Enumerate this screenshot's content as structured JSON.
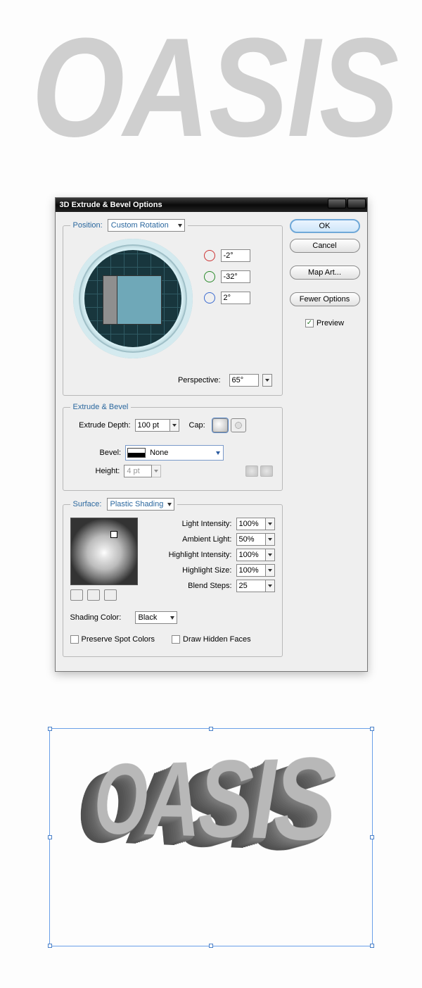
{
  "oasis_text": "OASIS",
  "dialog": {
    "title": "3D Extrude & Bevel Options",
    "buttons": {
      "ok": "OK",
      "cancel": "Cancel",
      "map_art": "Map Art...",
      "fewer_options": "Fewer Options"
    },
    "preview": {
      "label": "Preview",
      "checked": true
    },
    "position": {
      "legend": "Position:",
      "preset": "Custom Rotation",
      "rot_x": "-2°",
      "rot_y": "-32°",
      "rot_z": "2°",
      "perspective_label": "Perspective:",
      "perspective": "65°"
    },
    "extrude": {
      "legend": "Extrude & Bevel",
      "depth_label": "Extrude Depth:",
      "depth": "100 pt",
      "cap_label": "Cap:",
      "bevel_label": "Bevel:",
      "bevel": "None",
      "height_label": "Height:",
      "height": "4 pt"
    },
    "surface": {
      "legend": "Surface:",
      "shading": "Plastic Shading",
      "light_intensity_label": "Light Intensity:",
      "light_intensity": "100%",
      "ambient_label": "Ambient Light:",
      "ambient": "50%",
      "highlight_intensity_label": "Highlight Intensity:",
      "highlight_intensity": "100%",
      "highlight_size_label": "Highlight Size:",
      "highlight_size": "100%",
      "blend_steps_label": "Blend Steps:",
      "blend_steps": "25",
      "shading_color_label": "Shading Color:",
      "shading_color": "Black",
      "preserve_spot_label": "Preserve Spot Colors",
      "draw_hidden_label": "Draw Hidden Faces"
    }
  }
}
